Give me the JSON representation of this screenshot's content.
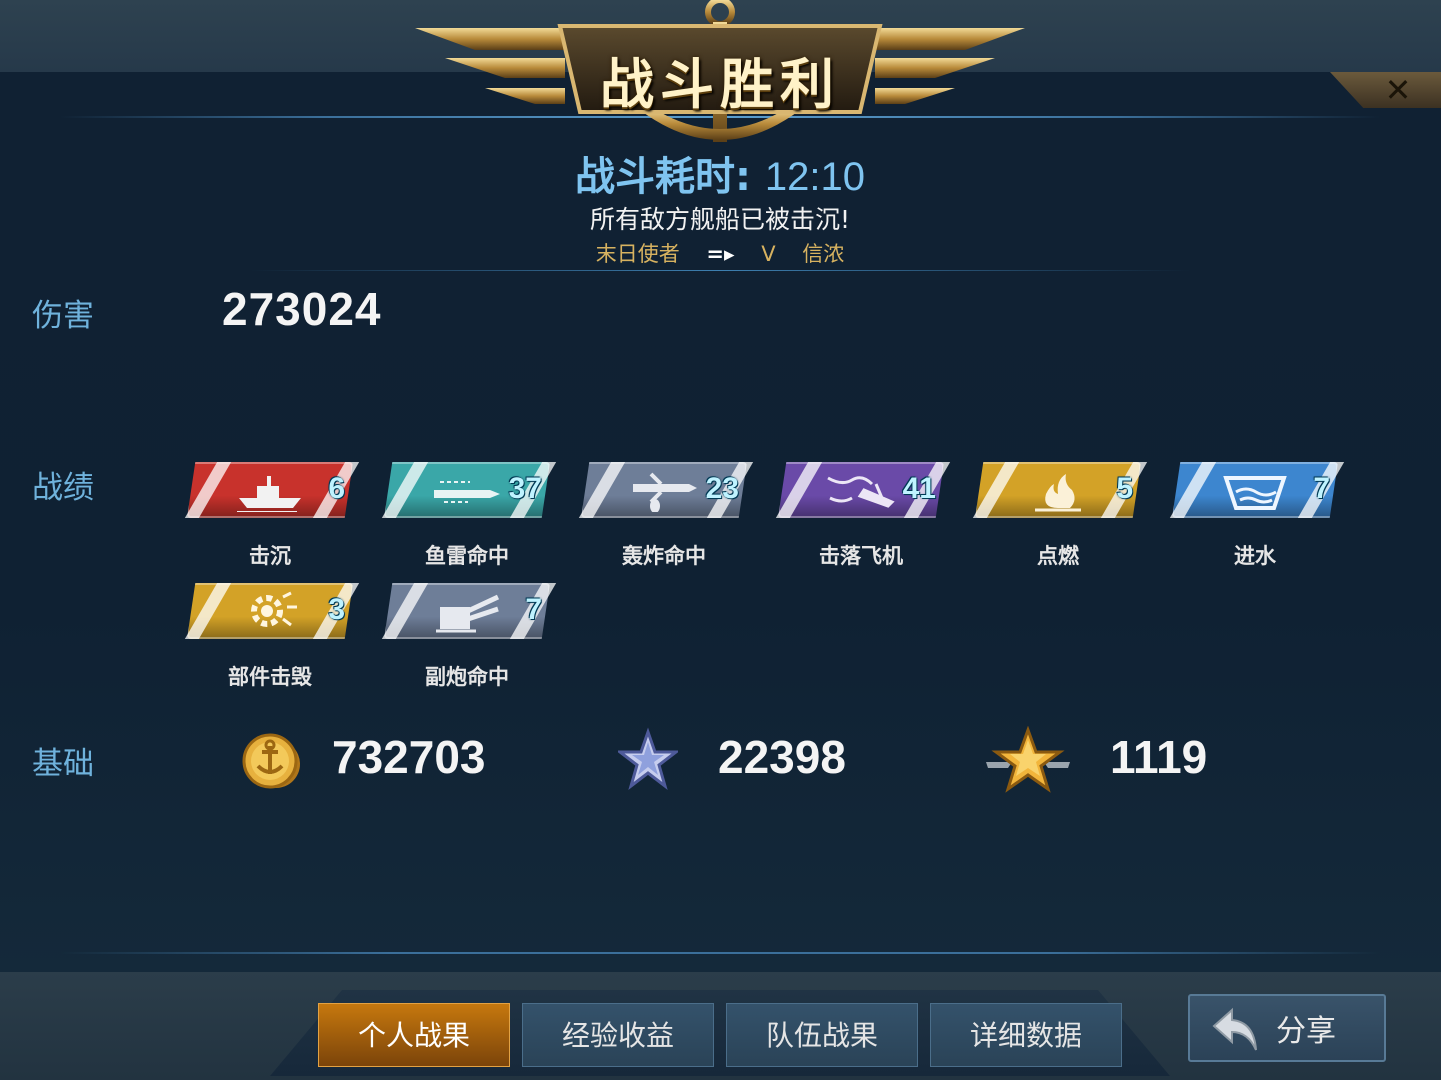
{
  "header": {
    "title": "战斗胜利",
    "duration_label": "战斗耗时:",
    "duration_value": "12:10",
    "subtitle": "所有敌方舰船已被击沉!",
    "player": "末日使者",
    "vs": "V",
    "ship": "信浓"
  },
  "sections": {
    "damage_label": "伤害",
    "damage_value": "273024",
    "record_label": "战绩",
    "base_label": "基础"
  },
  "badges": [
    {
      "label": "击沉",
      "count": "6",
      "icon": "sink-ship-icon",
      "color": "#c8322c"
    },
    {
      "label": "鱼雷命中",
      "count": "37",
      "icon": "torpedo-icon",
      "color": "#3aa7a8"
    },
    {
      "label": "轰炸命中",
      "count": "23",
      "icon": "bomb-plane-icon",
      "color": "#6e7e98"
    },
    {
      "label": "击落飞机",
      "count": "41",
      "icon": "shot-down-plane-icon",
      "color": "#6a4aa8"
    },
    {
      "label": "点燃",
      "count": "5",
      "icon": "fire-icon",
      "color": "#d3a227"
    },
    {
      "label": "进水",
      "count": "7",
      "icon": "flooding-icon",
      "color": "#3d86cf"
    },
    {
      "label": "部件击毁",
      "count": "3",
      "icon": "gear-destroy-icon",
      "color": "#d3a227"
    },
    {
      "label": "副炮命中",
      "count": "7",
      "icon": "secondary-gun-icon",
      "color": "#6e7e98"
    }
  ],
  "base": {
    "coins": "732703",
    "exp": "22398",
    "rank": "1119"
  },
  "tabs": [
    "个人战果",
    "经验收益",
    "队伍战果",
    "详细数据"
  ],
  "active_tab": 0,
  "share_label": "分享"
}
